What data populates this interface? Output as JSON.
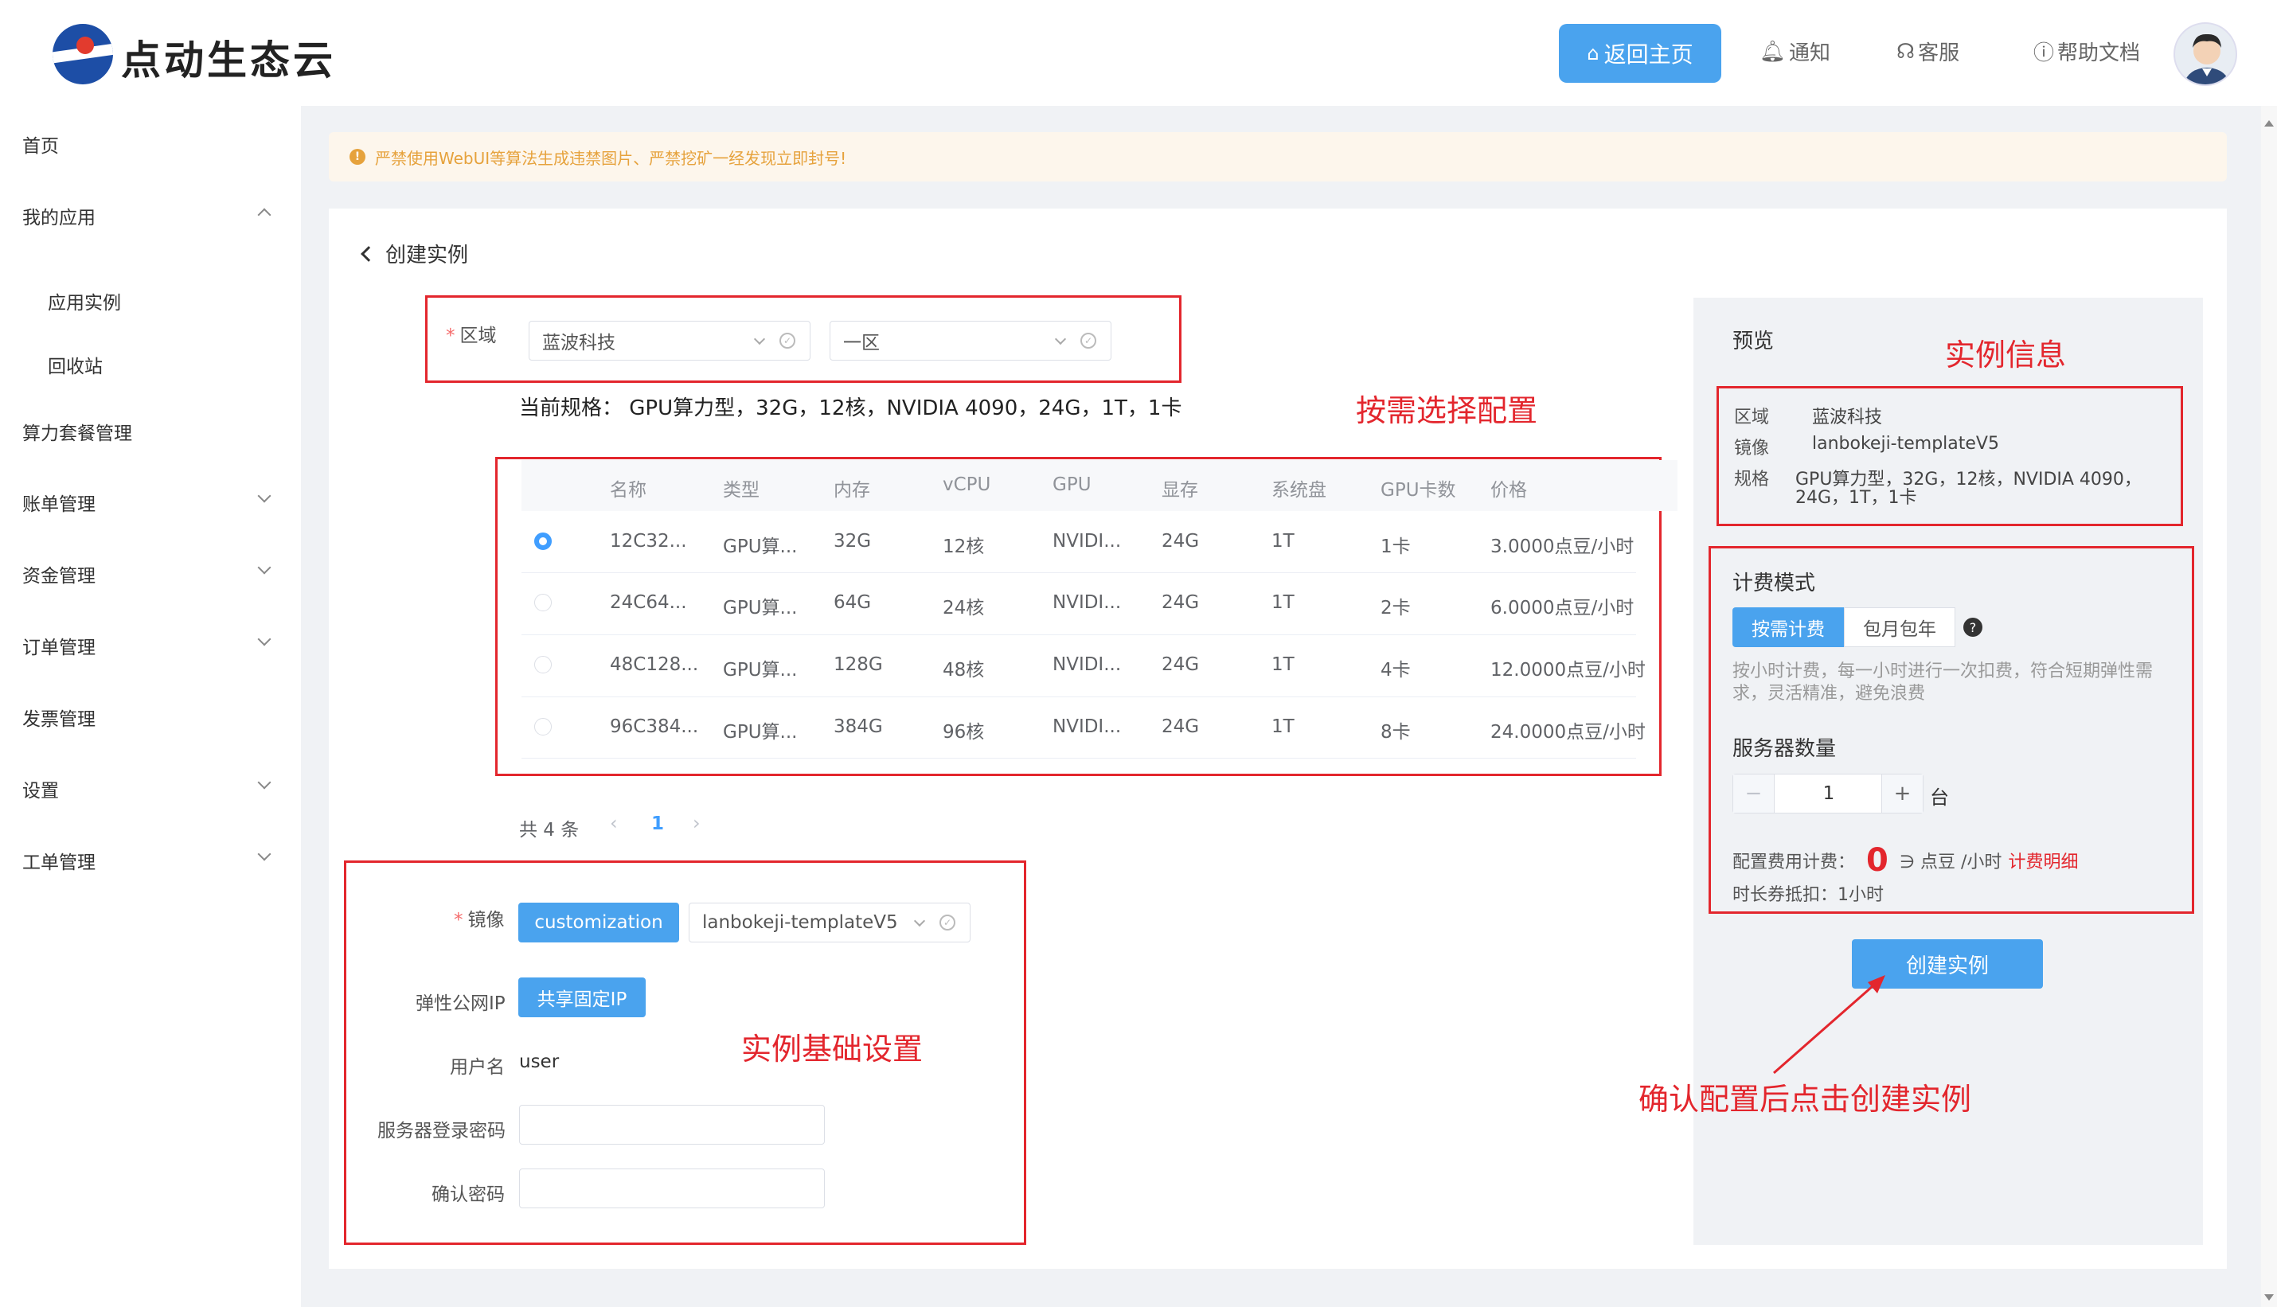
{
  "header": {
    "logo_text": "点动生态云",
    "home_button": "返回主页",
    "notify_link": "通知",
    "service_link": "客服",
    "help_link": "帮助文档"
  },
  "sidebar": {
    "items": [
      {
        "label": "首页"
      },
      {
        "label": "我的应用"
      },
      {
        "label": "应用实例"
      },
      {
        "label": "回收站"
      },
      {
        "label": "算力套餐管理"
      },
      {
        "label": "账单管理"
      },
      {
        "label": "资金管理"
      },
      {
        "label": "订单管理"
      },
      {
        "label": "发票管理"
      },
      {
        "label": "设置"
      },
      {
        "label": "工单管理"
      }
    ]
  },
  "notice": "严禁使用WebUI等算法生成违禁图片、严禁挖矿一经发现立即封号!",
  "page": {
    "back_title": "创建实例",
    "region_label": "区域",
    "region_value": "蓝波科技",
    "zone_value": "一区",
    "current_spec_label": "当前规格：",
    "current_spec_value": "GPU算力型，32G，12核，NVIDIA 4090，24G，1T，1卡"
  },
  "table": {
    "headers": [
      "名称",
      "类型",
      "内存",
      "vCPU",
      "GPU",
      "显存",
      "系统盘",
      "GPU卡数",
      "价格"
    ],
    "rows": [
      [
        "12C32...",
        "GPU算...",
        "32G",
        "12核",
        "NVIDI...",
        "24G",
        "1T",
        "1卡",
        "3.0000点豆/小时"
      ],
      [
        "24C64...",
        "GPU算...",
        "64G",
        "24核",
        "NVIDI...",
        "24G",
        "1T",
        "2卡",
        "6.0000点豆/小时"
      ],
      [
        "48C128...",
        "GPU算...",
        "128G",
        "48核",
        "NVIDI...",
        "24G",
        "1T",
        "4卡",
        "12.0000点豆/小时"
      ],
      [
        "96C384...",
        "GPU算...",
        "384G",
        "96核",
        "NVIDI...",
        "24G",
        "1T",
        "8卡",
        "24.0000点豆/小时"
      ]
    ],
    "selected_index": 0,
    "pagination_total": "共 4 条",
    "pagination_page": "1"
  },
  "form": {
    "image_label": "镜像",
    "image_type_button": "customization",
    "image_value": "lanbokeji-templateV5",
    "ip_label": "弹性公网IP",
    "ip_button": "共享固定IP",
    "username_label": "用户名",
    "username_value": "user",
    "password_label": "服务器登录密码",
    "confirm_label": "确认密码"
  },
  "preview": {
    "title": "预览",
    "region_k": "区域",
    "region_v": "蓝波科技",
    "image_k": "镜像",
    "image_v": "lanbokeji-templateV5",
    "spec_k": "规格",
    "spec_v1": "GPU算力型，32G，12核，NVIDIA 4090，",
    "spec_v2": "24G，1T，1卡",
    "billing_title": "计费模式",
    "billing_on_demand": "按需计费",
    "billing_monthly": "包月包年",
    "billing_desc1": "按小时计费，每一小时进行一次扣费，符合短期弹性需",
    "billing_desc2": "求，灵活精准，避免浪费",
    "server_count_title": "服务器数量",
    "server_count": "1",
    "server_unit": "台",
    "cost_label": "配置费用计费：",
    "cost_value": "0",
    "cost_unit": "∋ 点豆 /小时",
    "cost_detail": "计费明细",
    "voucher": "时长券抵扣：1小时",
    "create_button": "创建实例"
  },
  "annotations": {
    "select_config": "按需选择配置",
    "instance_info": "实例信息",
    "basic_settings": "实例基础设置",
    "confirm_create": "确认配置后点击创建实例"
  },
  "colors": {
    "accent": "#4aa3ee",
    "annotation_red": "#e3262d",
    "warning": "#e6a23c"
  }
}
